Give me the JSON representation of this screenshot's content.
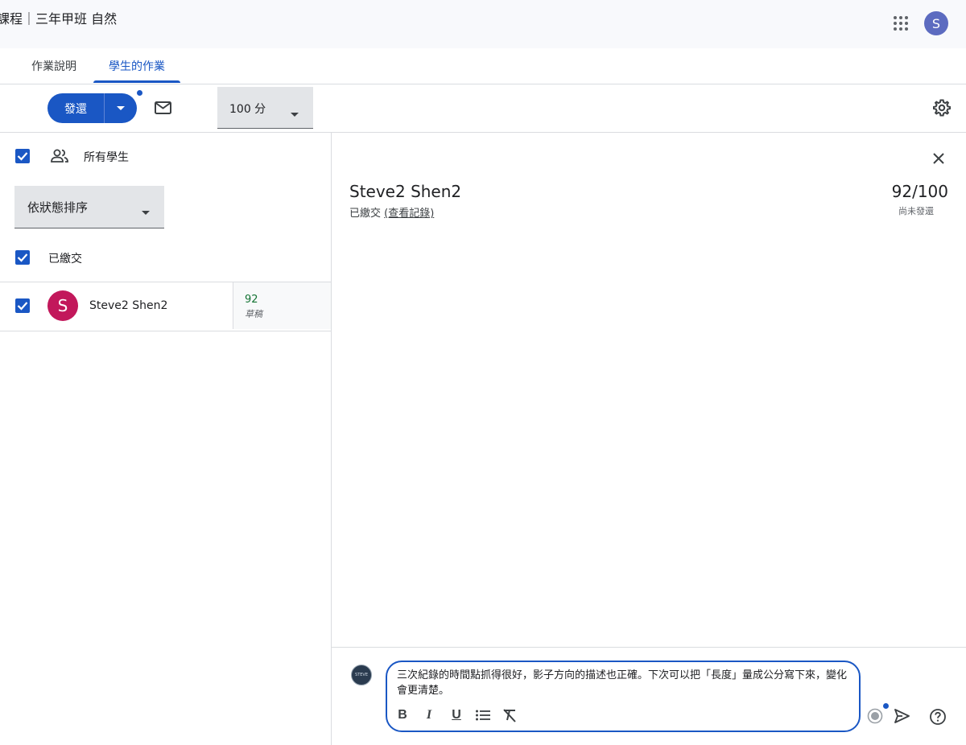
{
  "header": {
    "course_title": "課程｜三年甲班 自然",
    "user_avatar_letter": "S"
  },
  "tabs": [
    {
      "label": "作業說明",
      "active": false
    },
    {
      "label": "學生的作業",
      "active": true
    }
  ],
  "toolbar": {
    "return_label": "發還",
    "points_label": "100 分"
  },
  "left_pane": {
    "all_students_label": "所有學生",
    "sort_label": "依狀態排序",
    "section_label": "已繳交",
    "students": [
      {
        "avatar_letter": "S",
        "name": "Steve2 Shen2",
        "grade": "92",
        "grade_status": "草稿"
      }
    ]
  },
  "detail": {
    "student_name": "Steve2 Shen2",
    "status_prefix": "已繳交 ",
    "history_link": "(查看記錄)",
    "grade": "92/100",
    "grade_status": "尚未發還"
  },
  "comment": {
    "avatar_text": "STEVE",
    "text": "三次紀錄的時間點抓得很好，影子方向的描述也正確。下次可以把「長度」量成公分寫下來，變化會更清楚。",
    "format_bold": "B",
    "format_italic": "I",
    "format_underline": "U"
  },
  "colors": {
    "primary": "#1a57c4",
    "grade_green": "#137333",
    "student_avatar": "#c2185b",
    "user_avatar": "#5c6bc0"
  }
}
